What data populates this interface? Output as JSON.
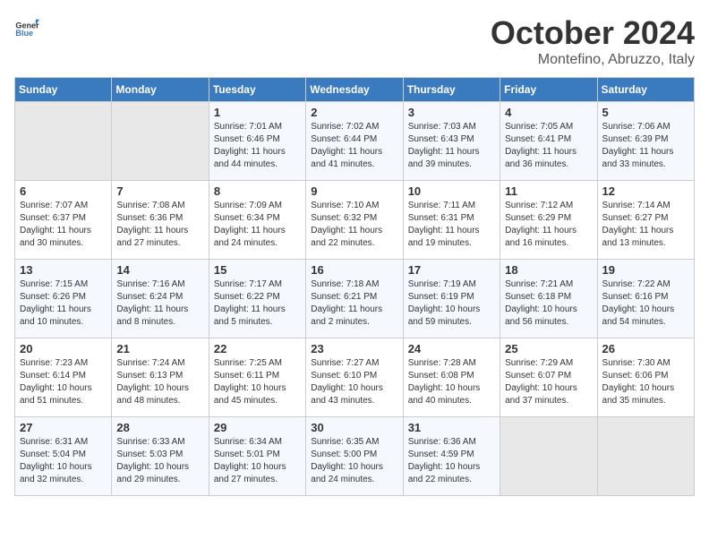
{
  "header": {
    "logo_general": "General",
    "logo_blue": "Blue",
    "month": "October 2024",
    "location": "Montefino, Abruzzo, Italy"
  },
  "days_of_week": [
    "Sunday",
    "Monday",
    "Tuesday",
    "Wednesday",
    "Thursday",
    "Friday",
    "Saturday"
  ],
  "weeks": [
    [
      {
        "day": "",
        "info": ""
      },
      {
        "day": "",
        "info": ""
      },
      {
        "day": "1",
        "info": "Sunrise: 7:01 AM\nSunset: 6:46 PM\nDaylight: 11 hours and 44 minutes."
      },
      {
        "day": "2",
        "info": "Sunrise: 7:02 AM\nSunset: 6:44 PM\nDaylight: 11 hours and 41 minutes."
      },
      {
        "day": "3",
        "info": "Sunrise: 7:03 AM\nSunset: 6:43 PM\nDaylight: 11 hours and 39 minutes."
      },
      {
        "day": "4",
        "info": "Sunrise: 7:05 AM\nSunset: 6:41 PM\nDaylight: 11 hours and 36 minutes."
      },
      {
        "day": "5",
        "info": "Sunrise: 7:06 AM\nSunset: 6:39 PM\nDaylight: 11 hours and 33 minutes."
      }
    ],
    [
      {
        "day": "6",
        "info": "Sunrise: 7:07 AM\nSunset: 6:37 PM\nDaylight: 11 hours and 30 minutes."
      },
      {
        "day": "7",
        "info": "Sunrise: 7:08 AM\nSunset: 6:36 PM\nDaylight: 11 hours and 27 minutes."
      },
      {
        "day": "8",
        "info": "Sunrise: 7:09 AM\nSunset: 6:34 PM\nDaylight: 11 hours and 24 minutes."
      },
      {
        "day": "9",
        "info": "Sunrise: 7:10 AM\nSunset: 6:32 PM\nDaylight: 11 hours and 22 minutes."
      },
      {
        "day": "10",
        "info": "Sunrise: 7:11 AM\nSunset: 6:31 PM\nDaylight: 11 hours and 19 minutes."
      },
      {
        "day": "11",
        "info": "Sunrise: 7:12 AM\nSunset: 6:29 PM\nDaylight: 11 hours and 16 minutes."
      },
      {
        "day": "12",
        "info": "Sunrise: 7:14 AM\nSunset: 6:27 PM\nDaylight: 11 hours and 13 minutes."
      }
    ],
    [
      {
        "day": "13",
        "info": "Sunrise: 7:15 AM\nSunset: 6:26 PM\nDaylight: 11 hours and 10 minutes."
      },
      {
        "day": "14",
        "info": "Sunrise: 7:16 AM\nSunset: 6:24 PM\nDaylight: 11 hours and 8 minutes."
      },
      {
        "day": "15",
        "info": "Sunrise: 7:17 AM\nSunset: 6:22 PM\nDaylight: 11 hours and 5 minutes."
      },
      {
        "day": "16",
        "info": "Sunrise: 7:18 AM\nSunset: 6:21 PM\nDaylight: 11 hours and 2 minutes."
      },
      {
        "day": "17",
        "info": "Sunrise: 7:19 AM\nSunset: 6:19 PM\nDaylight: 10 hours and 59 minutes."
      },
      {
        "day": "18",
        "info": "Sunrise: 7:21 AM\nSunset: 6:18 PM\nDaylight: 10 hours and 56 minutes."
      },
      {
        "day": "19",
        "info": "Sunrise: 7:22 AM\nSunset: 6:16 PM\nDaylight: 10 hours and 54 minutes."
      }
    ],
    [
      {
        "day": "20",
        "info": "Sunrise: 7:23 AM\nSunset: 6:14 PM\nDaylight: 10 hours and 51 minutes."
      },
      {
        "day": "21",
        "info": "Sunrise: 7:24 AM\nSunset: 6:13 PM\nDaylight: 10 hours and 48 minutes."
      },
      {
        "day": "22",
        "info": "Sunrise: 7:25 AM\nSunset: 6:11 PM\nDaylight: 10 hours and 45 minutes."
      },
      {
        "day": "23",
        "info": "Sunrise: 7:27 AM\nSunset: 6:10 PM\nDaylight: 10 hours and 43 minutes."
      },
      {
        "day": "24",
        "info": "Sunrise: 7:28 AM\nSunset: 6:08 PM\nDaylight: 10 hours and 40 minutes."
      },
      {
        "day": "25",
        "info": "Sunrise: 7:29 AM\nSunset: 6:07 PM\nDaylight: 10 hours and 37 minutes."
      },
      {
        "day": "26",
        "info": "Sunrise: 7:30 AM\nSunset: 6:06 PM\nDaylight: 10 hours and 35 minutes."
      }
    ],
    [
      {
        "day": "27",
        "info": "Sunrise: 6:31 AM\nSunset: 5:04 PM\nDaylight: 10 hours and 32 minutes."
      },
      {
        "day": "28",
        "info": "Sunrise: 6:33 AM\nSunset: 5:03 PM\nDaylight: 10 hours and 29 minutes."
      },
      {
        "day": "29",
        "info": "Sunrise: 6:34 AM\nSunset: 5:01 PM\nDaylight: 10 hours and 27 minutes."
      },
      {
        "day": "30",
        "info": "Sunrise: 6:35 AM\nSunset: 5:00 PM\nDaylight: 10 hours and 24 minutes."
      },
      {
        "day": "31",
        "info": "Sunrise: 6:36 AM\nSunset: 4:59 PM\nDaylight: 10 hours and 22 minutes."
      },
      {
        "day": "",
        "info": ""
      },
      {
        "day": "",
        "info": ""
      }
    ]
  ]
}
